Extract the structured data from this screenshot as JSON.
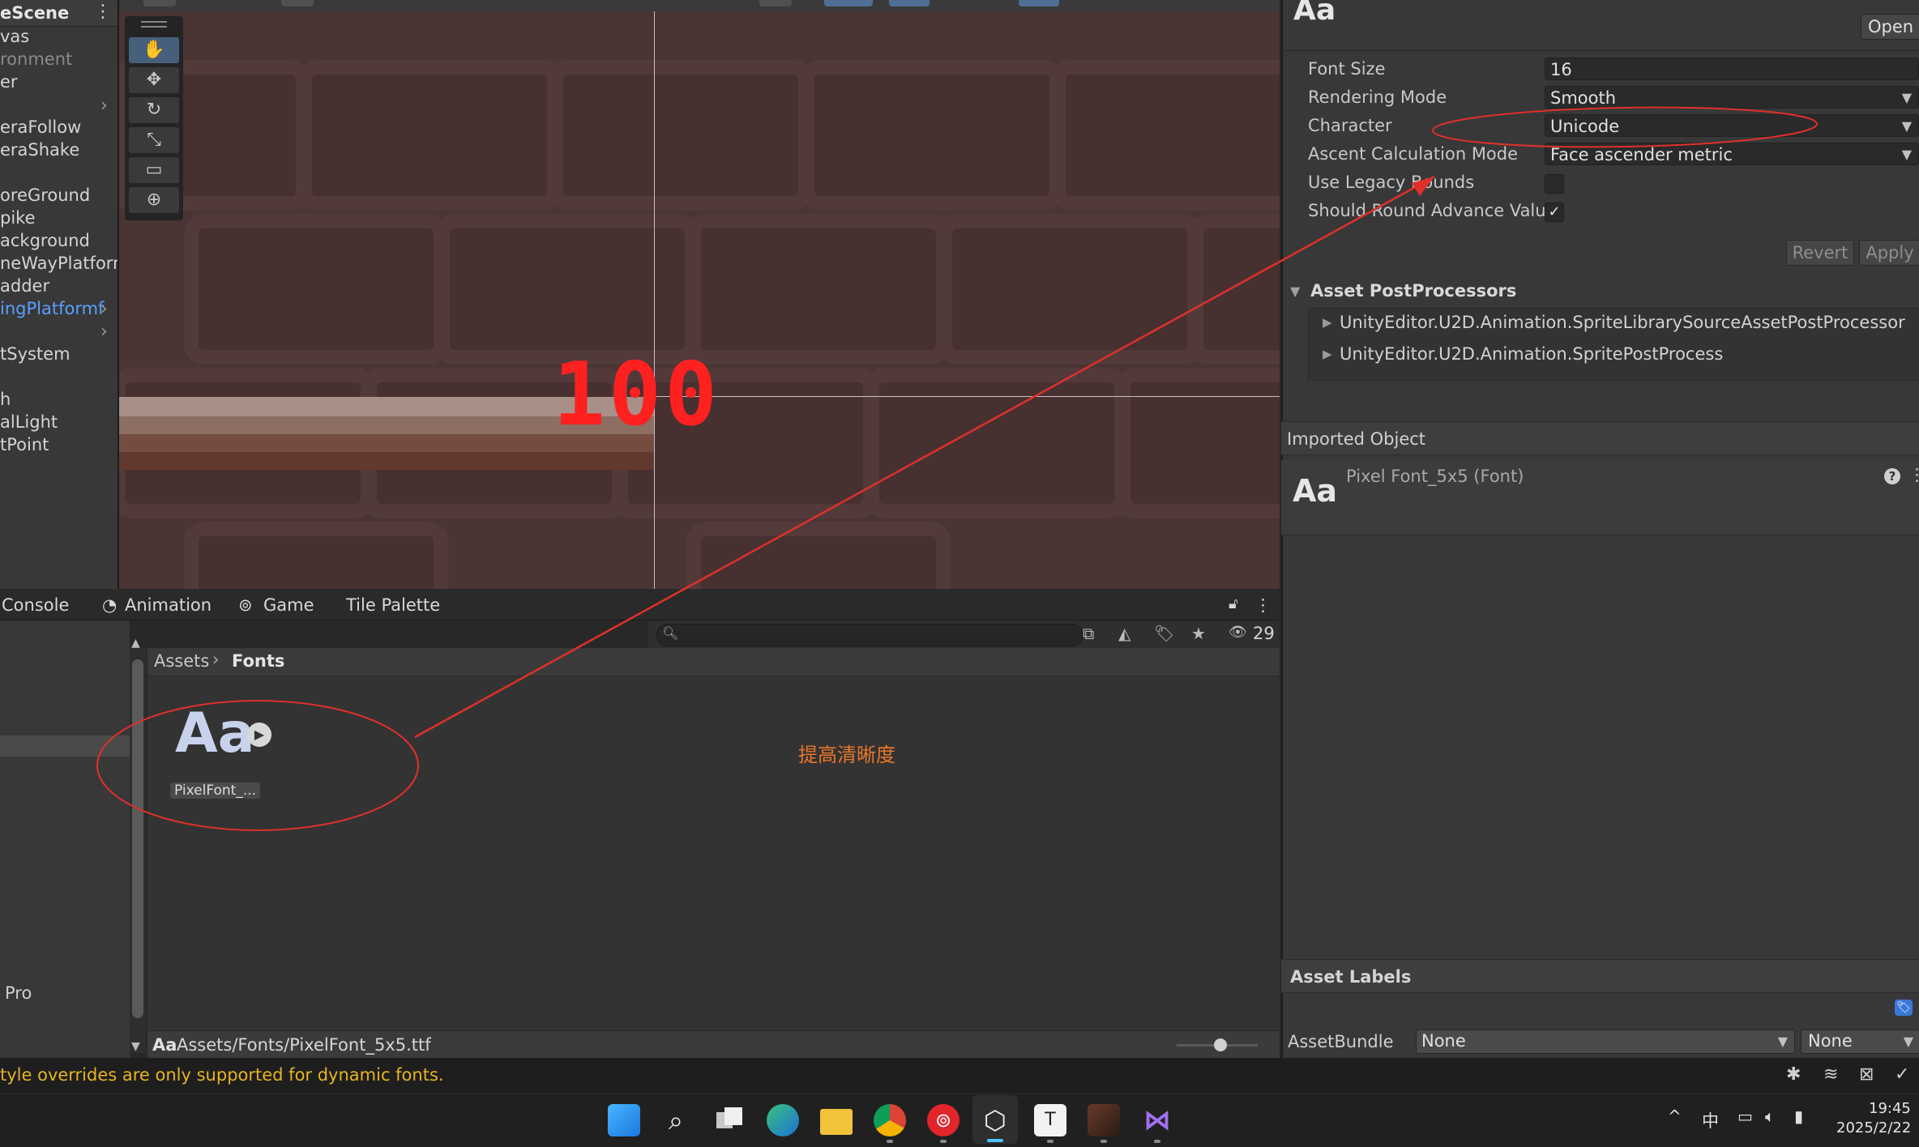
{
  "hierarchy": {
    "title": "eScene",
    "items": [
      {
        "label": "vas"
      },
      {
        "label": "ronment"
      },
      {
        "label": "er"
      },
      {
        "label": "eraFollow"
      },
      {
        "label": "eraShake"
      },
      {
        "label": "oreGround"
      },
      {
        "label": "pike"
      },
      {
        "label": "ackground"
      },
      {
        "label": "neWayPlatform"
      },
      {
        "label": "adder"
      },
      {
        "label": "ingPlatformf"
      },
      {
        "label": "tSystem"
      },
      {
        "label": "h"
      },
      {
        "label": "alLight"
      },
      {
        "label": "tPoint"
      }
    ]
  },
  "scene": {
    "damage_text": "100",
    "damage_color": "#ff2020"
  },
  "tabs": {
    "console": "Console",
    "animation": "Animation",
    "game": "Game",
    "tile_palette": "Tile Palette"
  },
  "project": {
    "search_placeholder": "",
    "hidden_count": "29",
    "breadcrumb_root": "Assets",
    "breadcrumb_current": "Fonts",
    "asset_icon_text": "Aa",
    "asset_label": "PixelFont_...",
    "left_label": "Pro",
    "path_icon": "Aa",
    "path": "Assets/Fonts/PixelFont_5x5.ttf",
    "annotation": "提高清晰度",
    "annotation_color": "#e8762a"
  },
  "inspector": {
    "header_icon": "Aa",
    "open_button": "Open",
    "fields": [
      {
        "label": "Font Size",
        "value": "16"
      },
      {
        "label": "Rendering Mode",
        "value": "Smooth"
      },
      {
        "label": "Character",
        "value": "Unicode"
      },
      {
        "label": "Ascent Calculation Mode",
        "value": "Face ascender metric"
      }
    ],
    "use_legacy_bounds": {
      "label": "Use Legacy Bounds",
      "checked": false
    },
    "should_round": {
      "label": "Should Round Advance Value",
      "checked": true,
      "mark": "✓"
    },
    "revert_button": "Revert",
    "apply_button": "Apply",
    "postprocessors": {
      "title": "Asset PostProcessors",
      "items": [
        "UnityEditor.U2D.Animation.SpriteLibrarySourceAssetPostProcessor",
        "UnityEditor.U2D.Animation.SpritePostProcess"
      ]
    },
    "imported_object": {
      "title": "Imported Object",
      "icon": "Aa",
      "name": "Pixel Font_5x5 (Font)"
    },
    "asset_labels": {
      "title": "Asset Labels",
      "assetbundle_label": "AssetBundle",
      "assetbundle_value": "None",
      "variant_value": "None"
    }
  },
  "status": {
    "message": "tyle overrides are only supported for dynamic fonts.",
    "color": "#e6b422"
  },
  "taskbar": {
    "ime": "中",
    "time": "19:45",
    "date": "2025/2/22"
  },
  "annotation_color": "#e0302a"
}
